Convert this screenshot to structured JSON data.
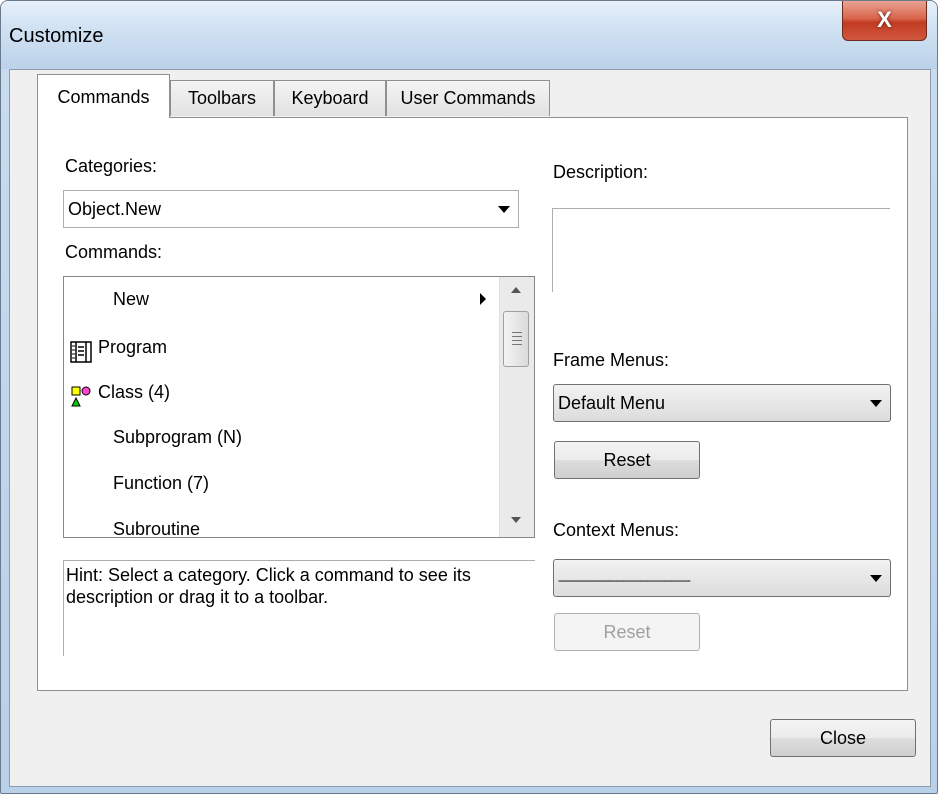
{
  "window": {
    "title": "Customize",
    "close_glyph": "X"
  },
  "tabs": [
    {
      "label": "Commands",
      "active": true
    },
    {
      "label": "Toolbars",
      "active": false
    },
    {
      "label": "Keyboard",
      "active": false
    },
    {
      "label": "User Commands",
      "active": false
    }
  ],
  "left": {
    "categories_label": "Categories:",
    "categories_value": "Object.New",
    "commands_label": "Commands:",
    "commands": [
      {
        "label": "New",
        "icon": "none",
        "submenu": true
      },
      {
        "label": "Program",
        "icon": "program-icon"
      },
      {
        "label": "Class (4)",
        "icon": "class-icon"
      },
      {
        "label": "Subprogram (N)",
        "icon": "none"
      },
      {
        "label": "Function (7)",
        "icon": "none"
      },
      {
        "label": "Subroutine",
        "icon": "none"
      }
    ],
    "hint": "Hint: Select a category. Click a command to see its description or drag it to a toolbar."
  },
  "right": {
    "description_label": "Description:",
    "description_value": "",
    "frame_menus_label": "Frame Menus:",
    "frame_menus_value": "Default Menu",
    "reset_label": "Reset",
    "context_menus_label": "Context Menus:",
    "context_menus_value": "--------------------------------------------",
    "context_reset_label": "Reset"
  },
  "footer": {
    "close_label": "Close"
  }
}
